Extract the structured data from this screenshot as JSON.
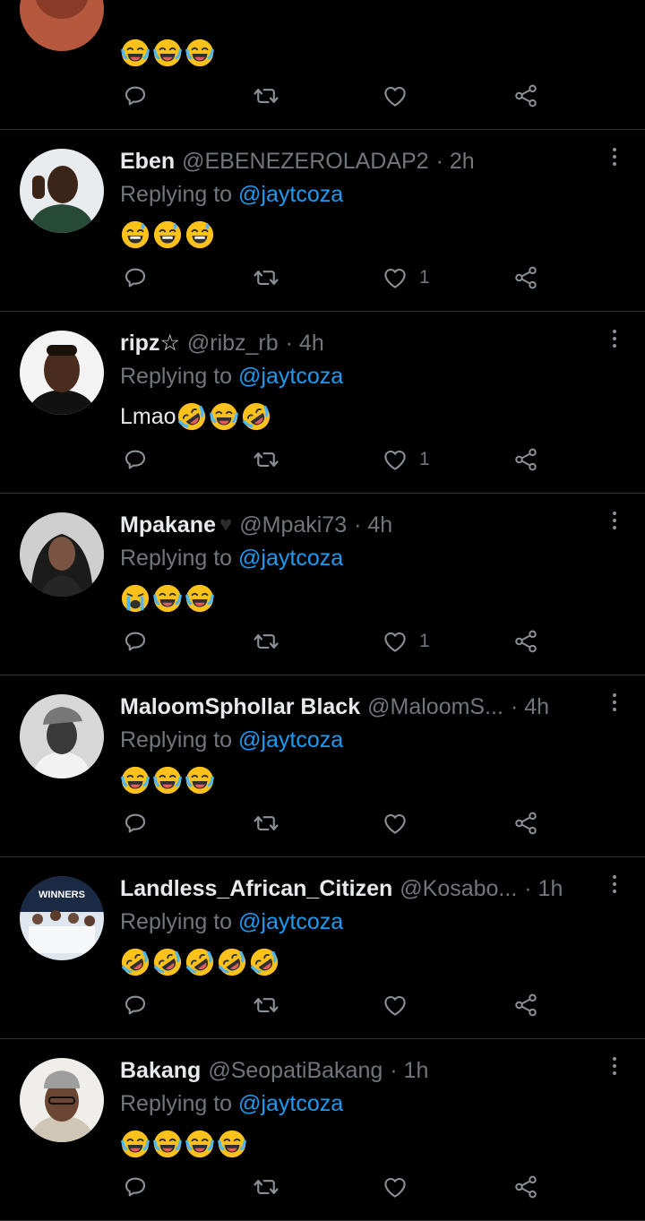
{
  "tweets": [
    {
      "name": "",
      "handle": "",
      "time": "",
      "reply_label": "",
      "mention": "",
      "text": "",
      "emojis": [
        "joy",
        "joy",
        "joy"
      ],
      "likes": "",
      "avatar": "partial"
    },
    {
      "name": "Eben",
      "handle": "@EBENEZEROLADAP2",
      "time": "· 2h",
      "reply_label": "Replying to",
      "mention": "@jaytcoza",
      "text": "",
      "emojis": [
        "sweat",
        "sweat",
        "sweat"
      ],
      "likes": "1",
      "avatar": "eben"
    },
    {
      "name": "ripz☆",
      "handle": "@ribz_rb",
      "time": "· 4h",
      "reply_label": "Replying to",
      "mention": "@jaytcoza",
      "text": "Lmao",
      "emojis": [
        "rofl",
        "joy",
        "rofl"
      ],
      "likes": "1",
      "avatar": "ripz"
    },
    {
      "name": "Mpakane",
      "handle": "@Mpaki73",
      "time": "· 4h",
      "reply_label": "Replying to",
      "mention": "@jaytcoza",
      "text": "",
      "emojis": [
        "sob",
        "joy",
        "joy"
      ],
      "likes": "1",
      "avatar": "mpakane",
      "heart": true
    },
    {
      "name": "MaloomSphollar Black",
      "handle": "@MaloomS...",
      "time": "· 4h",
      "reply_label": "Replying to",
      "mention": "@jaytcoza",
      "text": "",
      "emojis": [
        "joy",
        "joy",
        "joy"
      ],
      "likes": "",
      "avatar": "maloom"
    },
    {
      "name": "Landless_African_Citizen",
      "handle": "@Kosabo...",
      "time": "· 1h",
      "reply_label": "Replying to",
      "mention": "@jaytcoza",
      "text": "",
      "emojis": [
        "rofl",
        "rofl",
        "rofl",
        "rofl",
        "rofl"
      ],
      "likes": "",
      "avatar": "landless",
      "avatar_text": "WINNERS"
    },
    {
      "name": "Bakang",
      "handle": "@SeopatiBakang",
      "time": "· 1h",
      "reply_label": "Replying to",
      "mention": "@jaytcoza",
      "text": "",
      "emojis": [
        "joy",
        "joy",
        "joy",
        "joy"
      ],
      "likes": "",
      "avatar": "bakang"
    }
  ],
  "icons": {
    "reply": "reply-icon",
    "retweet": "retweet-icon",
    "like": "like-icon",
    "share": "share-icon",
    "more": "more-icon"
  },
  "colors": {
    "background": "#000000",
    "accent": "#1d9bf0",
    "muted": "#71767b",
    "divider": "#2f3336",
    "emoji_yellow": "#fcc21b"
  }
}
